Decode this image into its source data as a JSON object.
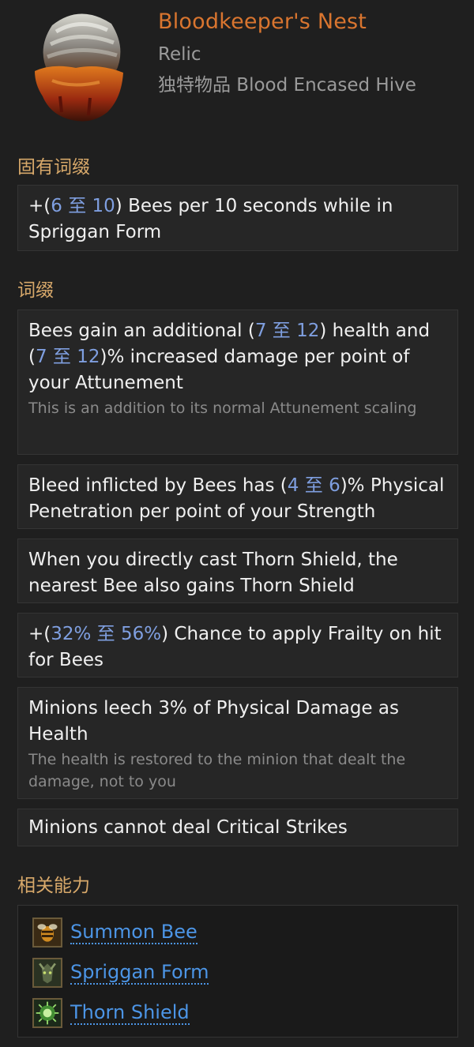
{
  "item": {
    "name": "Bloodkeeper's Nest",
    "type": "Relic",
    "subtitle": "独特物品 Blood Encased Hive"
  },
  "implicit": {
    "title": "固有词缀",
    "lines": [
      {
        "pre": "+(",
        "r1": "6",
        "mid": " 至 ",
        "r2": "10",
        "post": ") Bees per 10 seconds while in Spriggan Form"
      }
    ]
  },
  "affixes": {
    "title": "词缀",
    "items": [
      {
        "pre": "Bees gain an additional (",
        "r1": "7",
        "mid1": " 至 ",
        "r2": "12",
        "post1": ") health and (",
        "r3": "7",
        "mid2": " 至 ",
        "r4": "12",
        "post2": ")% increased damage per point of your Attunement",
        "note": "This is an addition to its normal Attunement scaling"
      },
      {
        "pre": "Bleed inflicted by Bees has (",
        "r1": "4",
        "mid": " 至 ",
        "r2": "6",
        "post": ")% Physical Penetration per point of your Strength"
      },
      {
        "text": "When you directly cast Thorn Shield, the nearest Bee also gains Thorn Shield"
      },
      {
        "pre": "+(",
        "r1": "32%",
        "mid": " 至 ",
        "r2": "56%",
        "post": ") Chance to apply Frailty on hit for Bees"
      },
      {
        "text": "Minions leech 3% of Physical Damage as Health",
        "note": "The health is restored to the minion that dealt the damage, not to you"
      },
      {
        "text": "Minions cannot deal Critical Strikes"
      }
    ]
  },
  "abilities": {
    "title": "相关能力",
    "items": [
      {
        "label": "Summon Bee",
        "icon": "bee-icon"
      },
      {
        "label": "Spriggan Form",
        "icon": "spriggan-icon"
      },
      {
        "label": "Thorn Shield",
        "icon": "thorn-shield-icon"
      }
    ]
  },
  "colors": {
    "name": "#d9752f",
    "section": "#d7a86a",
    "range": "#7f9fe0",
    "link": "#4c95e6"
  }
}
